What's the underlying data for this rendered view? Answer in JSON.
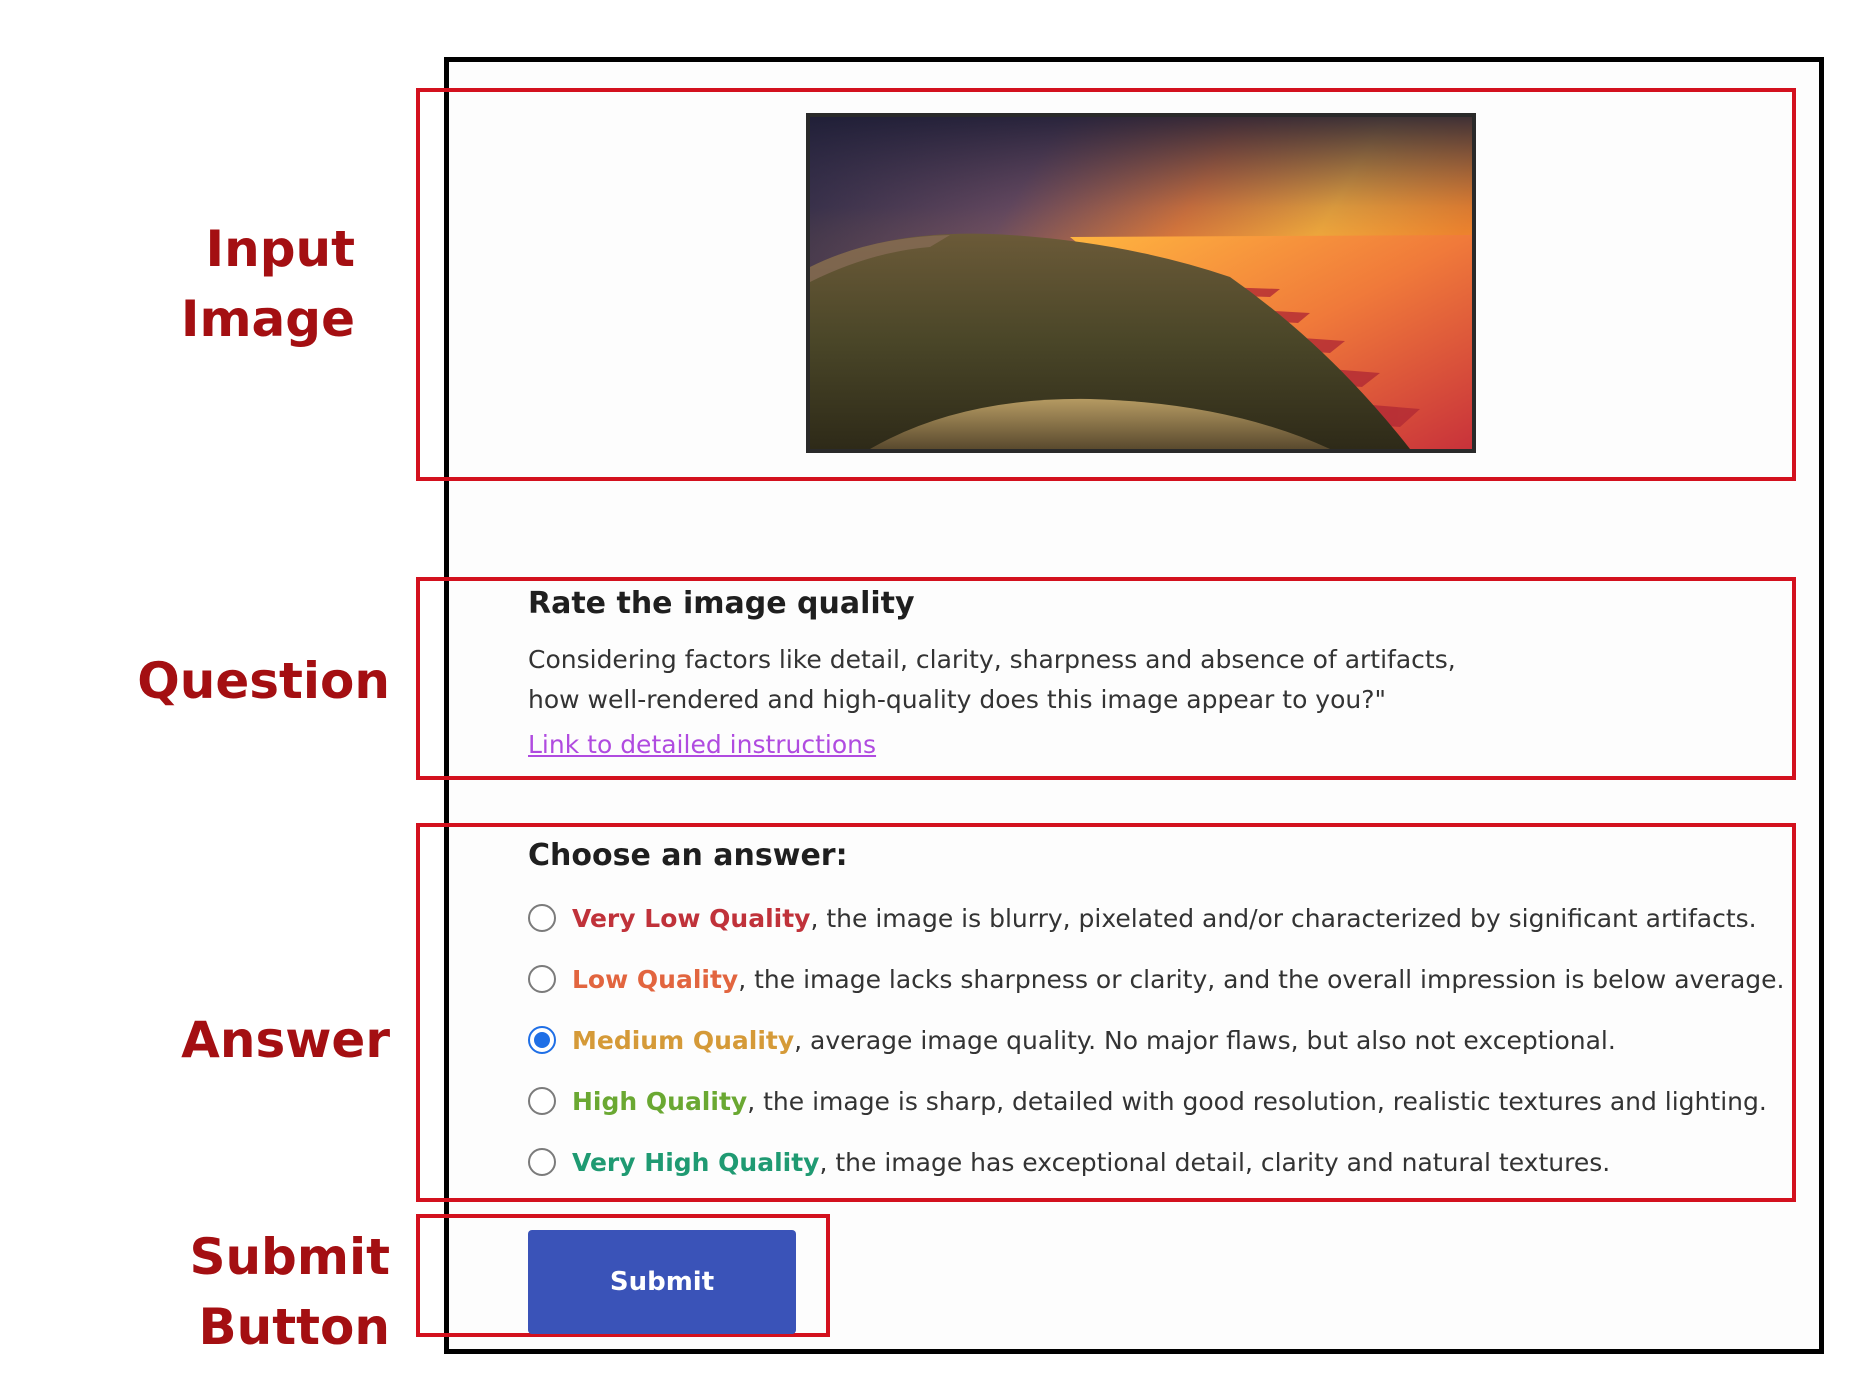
{
  "annotations": {
    "input_image": [
      "Input",
      "Image"
    ],
    "question": [
      "Question"
    ],
    "answer": [
      "Answer"
    ],
    "submit_button": [
      "Submit",
      "Button"
    ]
  },
  "question": {
    "title": "Rate the image quality",
    "line1": "Considering factors like detail, clarity, sharpness and absence of artifacts,",
    "line2": "how well-rendered and high-quality does this image appear to you?\"",
    "link_text": "Link to detailed instructions"
  },
  "answer": {
    "title": "Choose an answer:",
    "options": [
      {
        "name": "Very Low Quality",
        "desc": ", the image is blurry, pixelated and/or characterized by significant artifacts.",
        "color": "#c0323a",
        "selected": false
      },
      {
        "name": "Low Quality",
        "desc": ", the image lacks sharpness or clarity, and the overall impression is below average.",
        "color": "#e2653f",
        "selected": false
      },
      {
        "name": "Medium Quality",
        "desc": ", average image quality. No major flaws, but also not exceptional.",
        "color": "#d59a38",
        "selected": true
      },
      {
        "name": "High Quality",
        "desc": ", the image is sharp, detailed with good resolution, realistic textures and lighting.",
        "color": "#6aa832",
        "selected": false
      },
      {
        "name": "Very High Quality",
        "desc": ", the image has exceptional detail, clarity and natural textures.",
        "color": "#1f9a72",
        "selected": false
      }
    ]
  },
  "submit": {
    "label": "Submit"
  },
  "colors": {
    "annotation": "#a40f12",
    "highlight_box": "#d3111e",
    "button": "#3a53b8",
    "radio_selected": "#1f6fe6"
  }
}
